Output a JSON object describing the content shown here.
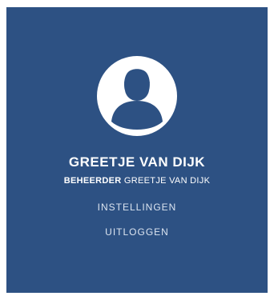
{
  "profile": {
    "avatar_icon": "user-avatar-icon",
    "name": "GREETJE VAN DIJK",
    "role": "BEHEERDER",
    "role_name": "GREETJE VAN DIJK"
  },
  "menu": {
    "settings_label": "INSTELLINGEN",
    "logout_label": "UITLOGGEN"
  },
  "colors": {
    "panel_background": "#2d5183",
    "avatar_background": "#ffffff",
    "text": "#ffffff"
  }
}
